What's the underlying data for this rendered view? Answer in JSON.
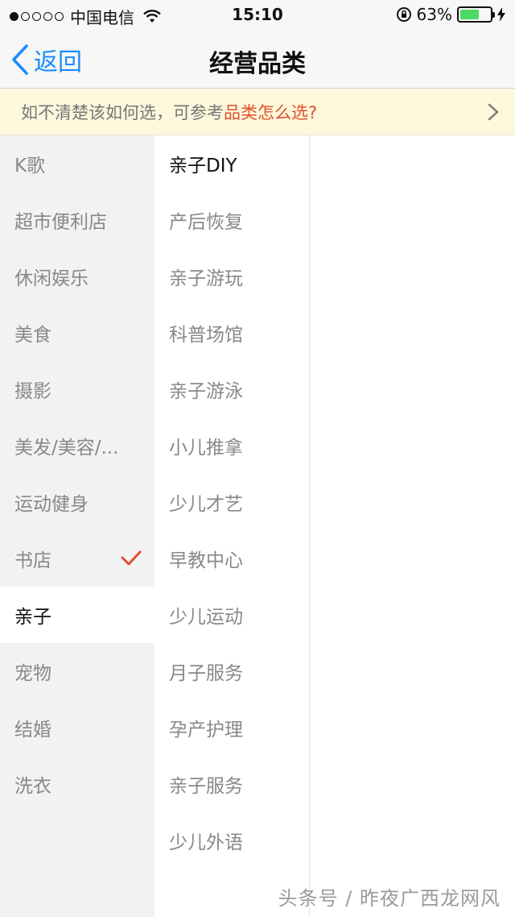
{
  "status_bar": {
    "carrier": "中国电信",
    "time": "15:10",
    "battery_percent": "63%",
    "battery_level": 0.63,
    "battery_color": "#4cd964"
  },
  "nav": {
    "back_label": "返回",
    "title": "经营品类",
    "accent_color": "#1a8cff"
  },
  "tip": {
    "text": "如不清楚该如何选，可参考",
    "link_text": "品类怎么选?",
    "link_color": "#e0502a"
  },
  "categories": [
    {
      "label": "K歌"
    },
    {
      "label": "超市便利店"
    },
    {
      "label": "休闲娱乐"
    },
    {
      "label": "美食"
    },
    {
      "label": "摄影"
    },
    {
      "label": "美发/美容/..."
    },
    {
      "label": "运动健身"
    },
    {
      "label": "书店",
      "checked": true
    },
    {
      "label": "亲子",
      "selected": true
    },
    {
      "label": "宠物"
    },
    {
      "label": "结婚"
    },
    {
      "label": "洗衣"
    }
  ],
  "subcategories": [
    {
      "label": "亲子DIY",
      "selected": true
    },
    {
      "label": "产后恢复"
    },
    {
      "label": "亲子游玩"
    },
    {
      "label": "科普场馆"
    },
    {
      "label": "亲子游泳"
    },
    {
      "label": "小儿推拿"
    },
    {
      "label": "少儿才艺"
    },
    {
      "label": "早教中心"
    },
    {
      "label": "少儿运动"
    },
    {
      "label": "月子服务"
    },
    {
      "label": "孕产护理"
    },
    {
      "label": "亲子服务"
    },
    {
      "label": "少儿外语"
    }
  ],
  "watermark": "头条号 / 昨夜广西龙网风"
}
